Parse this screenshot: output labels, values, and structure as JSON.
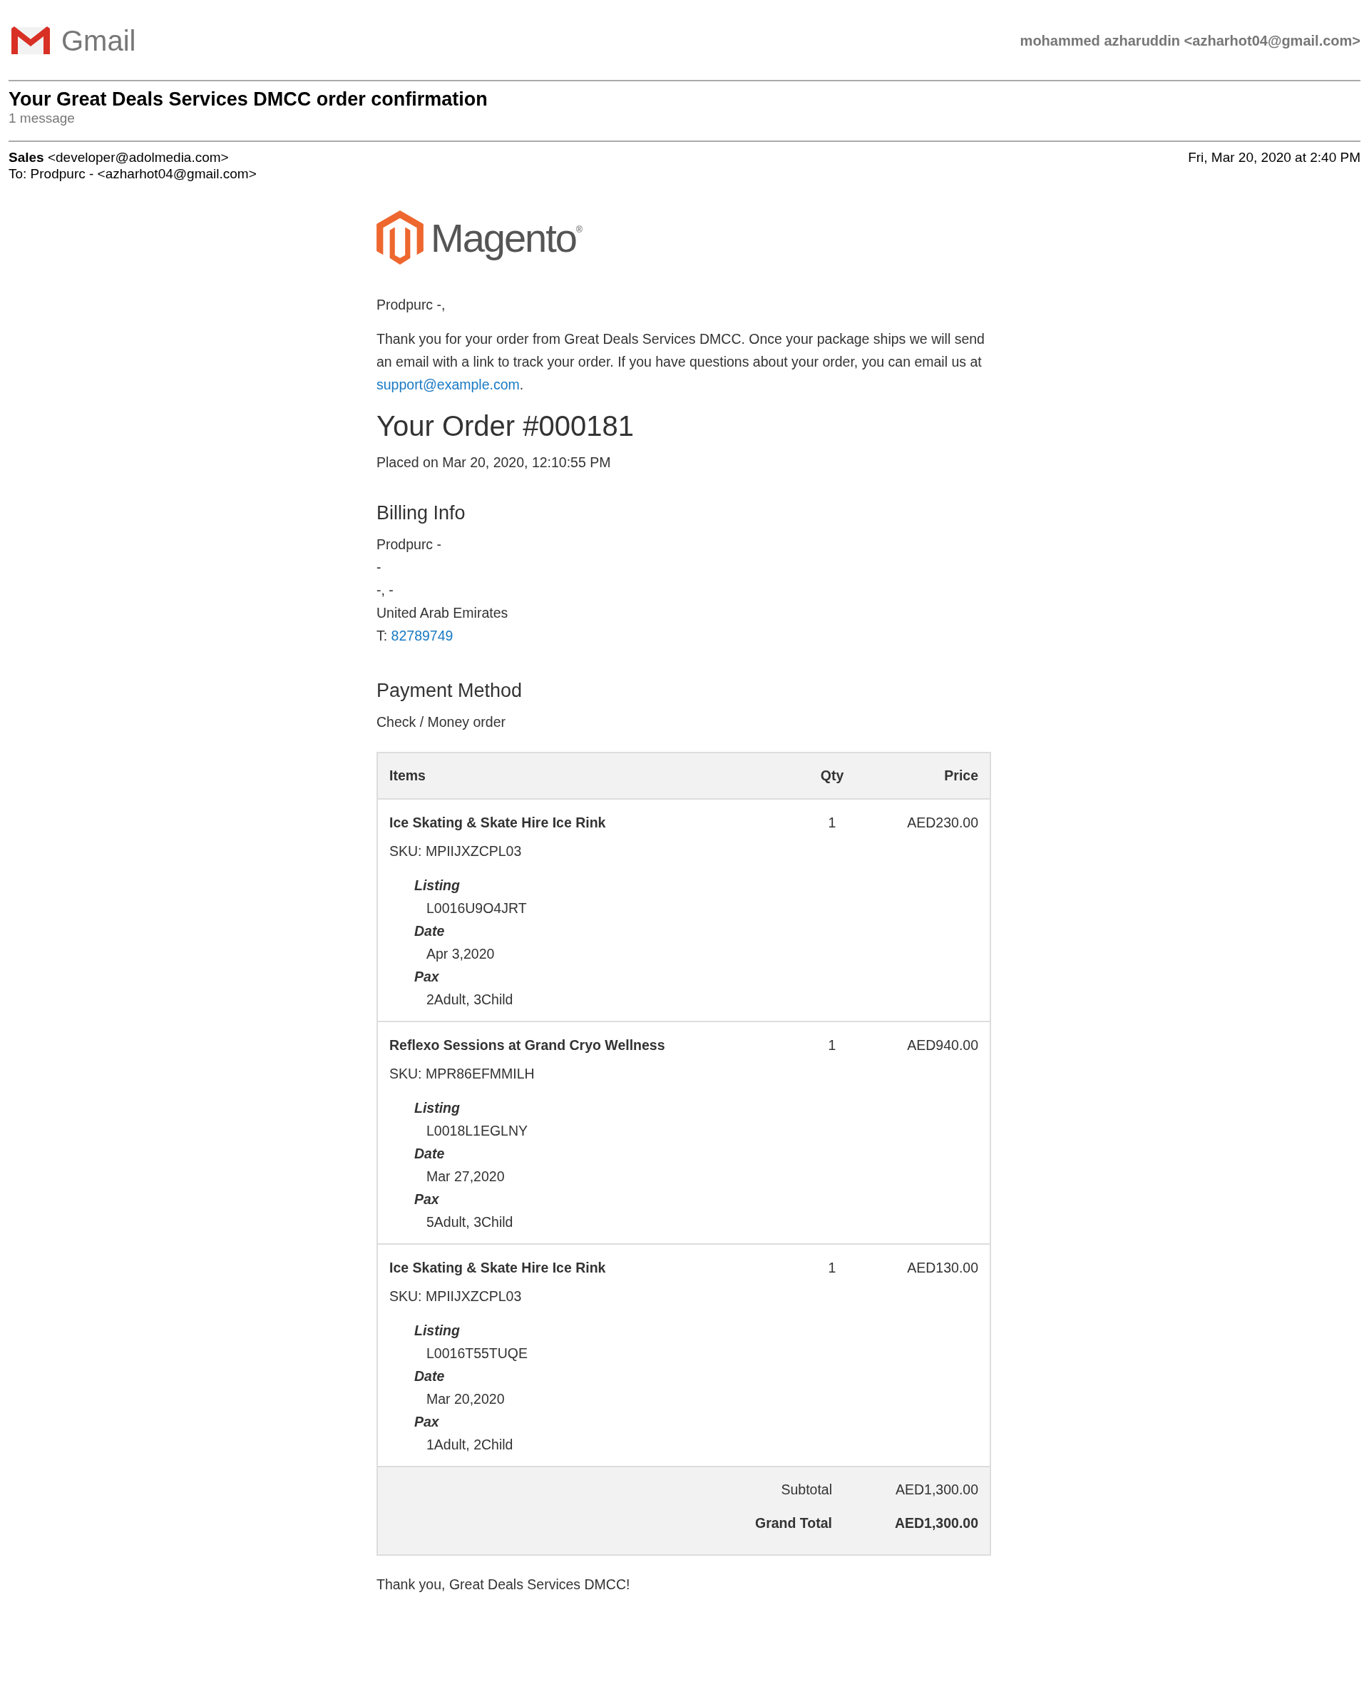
{
  "header": {
    "logo_text": "Gmail",
    "account": "mohammed azharuddin <azharhot04@gmail.com>"
  },
  "thread": {
    "subject": "Your Great Deals Services DMCC order confirmation",
    "count": "1 message"
  },
  "message": {
    "sender_name": "Sales",
    "sender_email": "<developer@adolmedia.com>",
    "to": "To: Prodpurc - <azharhot04@gmail.com>",
    "date": "Fri, Mar 20, 2020 at 2:40 PM"
  },
  "email": {
    "logo_text": "Magento",
    "logo_mark": "®",
    "greeting": "Prodpurc -,",
    "intro": "Thank you for your order from Great Deals Services DMCC. Once your package ships we will send an email with a link to track your order. If you have questions about your order, you can email us at",
    "support_link": "support@example.com",
    "intro_end": ".",
    "order_title": "Your Order #000181",
    "placed": "Placed on Mar 20, 2020, 12:10:55 PM",
    "billing": {
      "heading": "Billing Info",
      "lines": [
        "Prodpurc -",
        "-",
        "-, -",
        "United Arab Emirates"
      ],
      "phone_label": "T:",
      "phone": "82789749"
    },
    "payment": {
      "heading": "Payment Method",
      "method": "Check / Money order"
    },
    "table": {
      "columns": [
        "Items",
        "Qty",
        "Price"
      ],
      "rows": [
        {
          "name": "Ice Skating & Skate Hire Ice Rink",
          "sku": "SKU: MPIIJXZCPL03",
          "qty": "1",
          "price": "AED230.00",
          "options": [
            {
              "label": "Listing",
              "value": "L0016U9O4JRT"
            },
            {
              "label": "Date",
              "value": "Apr 3,2020"
            },
            {
              "label": "Pax",
              "value": "2Adult, 3Child"
            }
          ]
        },
        {
          "name": "Reflexo Sessions at Grand Cryo Wellness",
          "sku": "SKU: MPR86EFMMILH",
          "qty": "1",
          "price": "AED940.00",
          "options": [
            {
              "label": "Listing",
              "value": "L0018L1EGLNY"
            },
            {
              "label": "Date",
              "value": "Mar 27,2020"
            },
            {
              "label": "Pax",
              "value": "5Adult, 3Child"
            }
          ]
        },
        {
          "name": "Ice Skating & Skate Hire Ice Rink",
          "sku": "SKU: MPIIJXZCPL03",
          "qty": "1",
          "price": "AED130.00",
          "options": [
            {
              "label": "Listing",
              "value": "L0016T55TUQE"
            },
            {
              "label": "Date",
              "value": "Mar 20,2020"
            },
            {
              "label": "Pax",
              "value": "1Adult, 2Child"
            }
          ]
        }
      ],
      "totals": [
        {
          "kind": "subtotal",
          "label": "Subtotal",
          "value": "AED1,300.00"
        },
        {
          "kind": "grand",
          "label": "Grand Total",
          "value": "AED1,300.00"
        }
      ]
    },
    "closing": "Thank you, Great Deals Services DMCC!"
  }
}
